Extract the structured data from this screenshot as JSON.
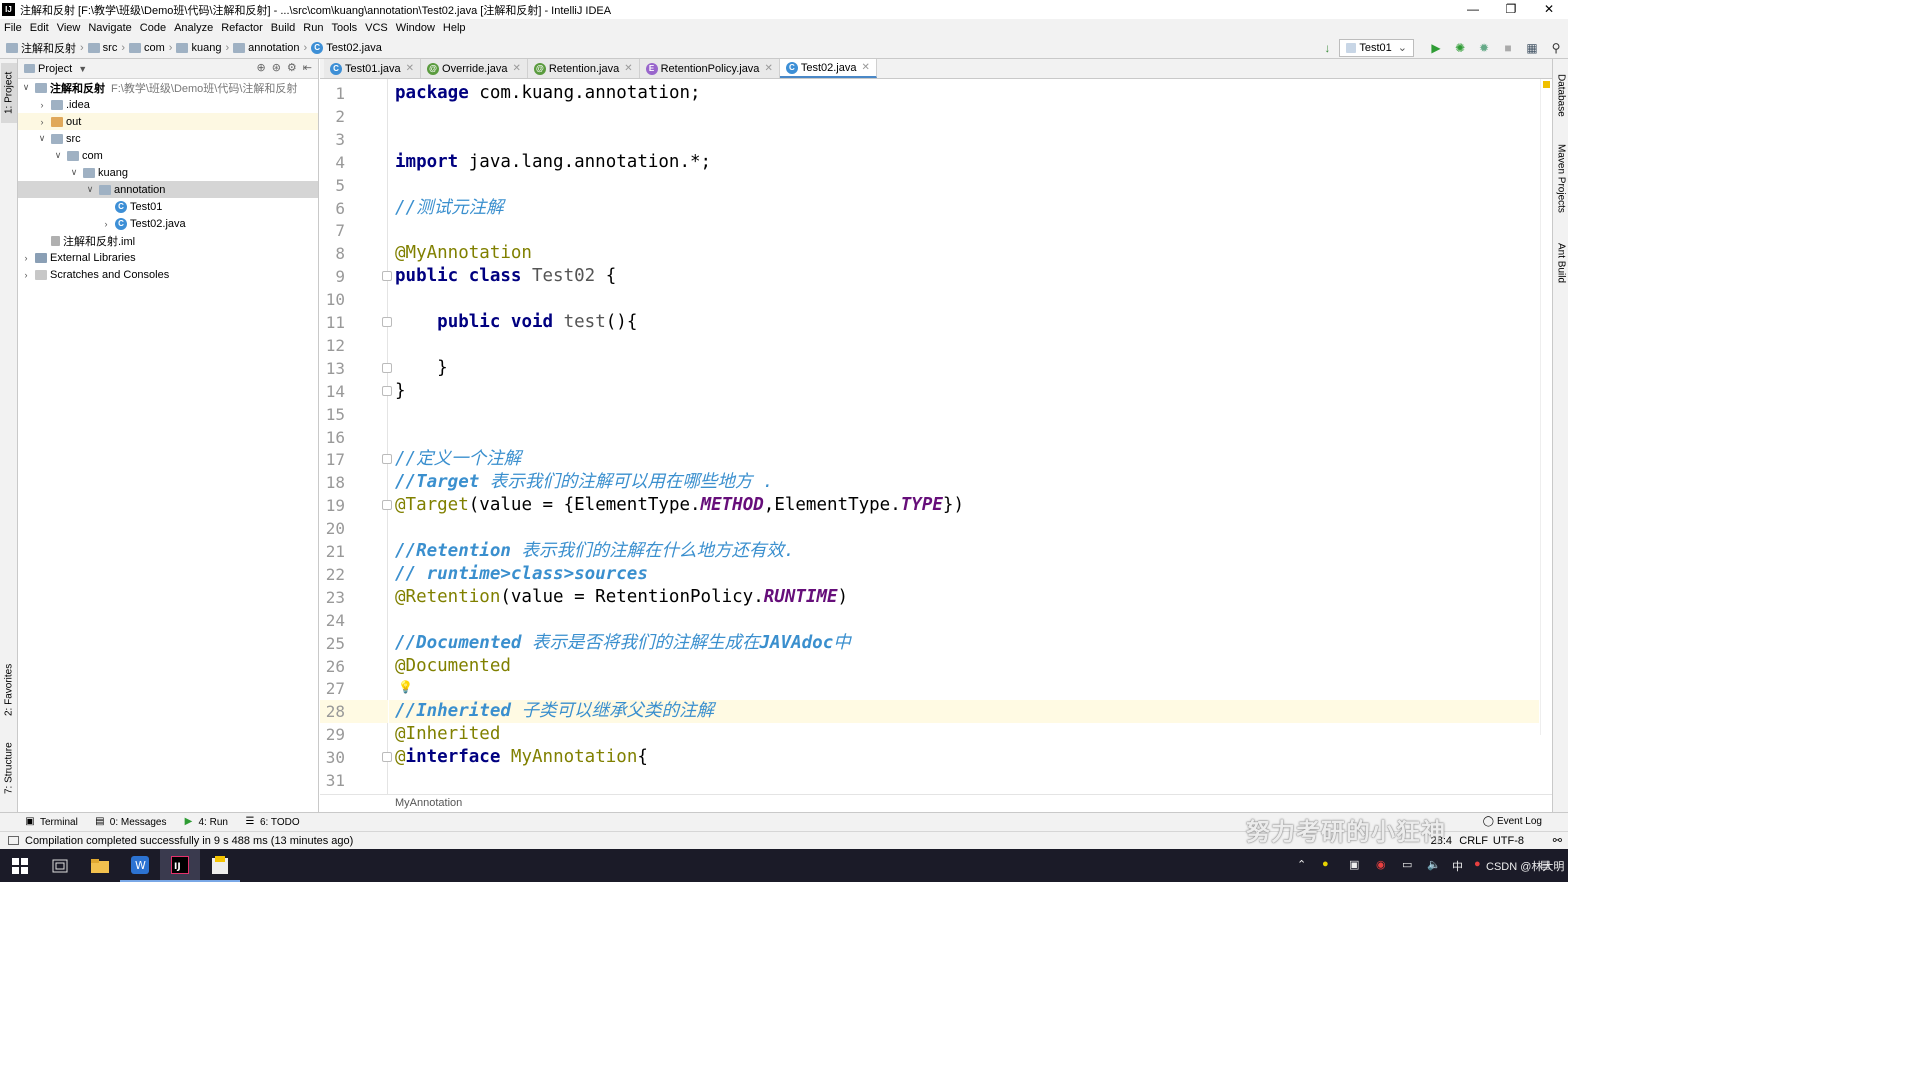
{
  "window": {
    "title": "注解和反射 [F:\\教学\\班级\\Demo班\\代码\\注解和反射] - ...\\src\\com\\kuang\\annotation\\Test02.java [注解和反射] - IntelliJ IDEA",
    "app_icon": "IJ"
  },
  "menu": [
    "File",
    "Edit",
    "View",
    "Navigate",
    "Code",
    "Analyze",
    "Refactor",
    "Build",
    "Run",
    "Tools",
    "VCS",
    "Window",
    "Help"
  ],
  "breadcrumbs": [
    "注解和反射",
    "src",
    "com",
    "kuang",
    "annotation",
    "Test02.java"
  ],
  "run_config": {
    "selected": "Test01"
  },
  "left_tabs": {
    "project": "1: Project",
    "favorites": "2: Favorites",
    "structure": "7: Structure"
  },
  "right_tabs": {
    "database": "Database",
    "maven": "Maven Projects",
    "ant": "Ant Build"
  },
  "project_panel": {
    "header": "Project",
    "tree": [
      {
        "label": "注解和反射",
        "path": "F:\\教学\\班级\\Demo班\\代码\\注解和反射",
        "depth": 0,
        "arrow": "v",
        "icon": "folder-icon"
      },
      {
        "label": ".idea",
        "depth": 1,
        "arrow": ">",
        "icon": "folder-icon"
      },
      {
        "label": "out",
        "depth": 1,
        "arrow": ">",
        "icon": "folder-orange-icon"
      },
      {
        "label": "src",
        "depth": 1,
        "arrow": "v",
        "icon": "folder-icon"
      },
      {
        "label": "com",
        "depth": 2,
        "arrow": "v",
        "icon": "package-icon"
      },
      {
        "label": "kuang",
        "depth": 3,
        "arrow": "v",
        "icon": "package-icon"
      },
      {
        "label": "annotation",
        "depth": 4,
        "arrow": "v",
        "icon": "package-icon"
      },
      {
        "label": "Test01",
        "depth": 5,
        "arrow": "",
        "icon": "class-icon"
      },
      {
        "label": "Test02.java",
        "depth": 5,
        "arrow": ">",
        "icon": "class-icon"
      },
      {
        "label": "注解和反射.iml",
        "depth": 1,
        "arrow": "",
        "icon": "iml-icon"
      },
      {
        "label": "External Libraries",
        "depth": 0,
        "arrow": ">",
        "icon": "library-icon"
      },
      {
        "label": "Scratches and Consoles",
        "depth": 0,
        "arrow": ">",
        "icon": "scratch-icon"
      }
    ]
  },
  "tabs": [
    {
      "label": "Test01.java",
      "icon": "C"
    },
    {
      "label": "Override.java",
      "icon": "@"
    },
    {
      "label": "Retention.java",
      "icon": "@"
    },
    {
      "label": "RetentionPolicy.java",
      "icon": "E"
    },
    {
      "label": "Test02.java",
      "icon": "C"
    }
  ],
  "code": {
    "line_numbers": [
      "1",
      "2",
      "3",
      "4",
      "5",
      "6",
      "7",
      "8",
      "9",
      "10",
      "11",
      "12",
      "13",
      "14",
      "15",
      "16",
      "17",
      "18",
      "19",
      "20",
      "21",
      "22",
      "23",
      "24",
      "25",
      "26",
      "27",
      "28",
      "29",
      "30",
      "31"
    ],
    "lines": [
      [
        [
          "kw",
          "package"
        ],
        [
          "fn",
          " com.kuang.annotation;"
        ]
      ],
      [],
      [],
      [
        [
          "kw",
          "import"
        ],
        [
          "fn",
          " java.lang.annotation.*;"
        ]
      ],
      [],
      [
        [
          "cm",
          "//测试元注解"
        ]
      ],
      [],
      [
        [
          "an",
          "@MyAnnotation"
        ]
      ],
      [
        [
          "kw",
          "public class"
        ],
        [
          "fn",
          " "
        ],
        [
          "gr",
          "Test02"
        ],
        [
          "fn",
          " {"
        ]
      ],
      [],
      [
        [
          "fn",
          "    "
        ],
        [
          "kw",
          "public void"
        ],
        [
          "fn",
          " "
        ],
        [
          "gr",
          "test"
        ],
        [
          "fn",
          "(){"
        ]
      ],
      [],
      [
        [
          "fn",
          "    }"
        ]
      ],
      [
        [
          "fn",
          "}"
        ]
      ],
      [],
      [],
      [
        [
          "cm",
          "//定义一个注解"
        ]
      ],
      [
        [
          "cmb",
          "//Target"
        ],
        [
          "cm",
          " 表示我们的注解可以用在哪些地方 ."
        ]
      ],
      [
        [
          "an",
          "@Target"
        ],
        [
          "fn",
          "(value = {ElementType."
        ],
        [
          "cn",
          "METHOD"
        ],
        [
          "fn",
          ",ElementType."
        ],
        [
          "cn",
          "TYPE"
        ],
        [
          "fn",
          "})"
        ]
      ],
      [],
      [
        [
          "cmb",
          "//Retention"
        ],
        [
          "cm",
          " 表示我们的注解在什么地方还有效."
        ]
      ],
      [
        [
          "cmb",
          "// runtime>class>sources"
        ]
      ],
      [
        [
          "an",
          "@Retention"
        ],
        [
          "fn",
          "(value = RetentionPolicy."
        ],
        [
          "cn",
          "RUNTIME"
        ],
        [
          "fn",
          ")"
        ]
      ],
      [],
      [
        [
          "cmb",
          "//Documented"
        ],
        [
          "cm",
          " 表示是否将我们的注解生成在"
        ],
        [
          "cmb",
          "JAVAdoc"
        ],
        [
          "cm",
          "中"
        ]
      ],
      [
        [
          "an",
          "@Documented"
        ]
      ],
      [],
      [
        [
          "cmb",
          "//Inherited"
        ],
        [
          "cm",
          " 子类可以继承父类的注解"
        ]
      ],
      [
        [
          "an",
          "@Inherited"
        ]
      ],
      [
        [
          "an",
          "@"
        ],
        [
          "kw",
          "interface"
        ],
        [
          "fn",
          " "
        ],
        [
          "an",
          "MyAnnotation"
        ],
        [
          "fn",
          "{"
        ]
      ],
      []
    ],
    "current_line": 28,
    "fold_lines": [
      9,
      11,
      13,
      14,
      17,
      19,
      30
    ],
    "breadcrumb": "MyAnnotation"
  },
  "tool_windows": [
    {
      "label": "Terminal",
      "icon": "terminal-icon"
    },
    {
      "label": "0: Messages",
      "icon": "messages-icon"
    },
    {
      "label": "4: Run",
      "icon": "run-icon"
    },
    {
      "label": "6: TODO",
      "icon": "todo-icon"
    }
  ],
  "event_log": "Event Log",
  "status": {
    "message": "Compilation completed successfully in 9 s 488 ms (13 minutes ago)",
    "position": "28:4",
    "line_sep": "CRLF",
    "encoding": "UTF-8"
  },
  "watermark": "努力考研的小狂神",
  "taskbar": {
    "tray": [
      "中"
    ],
    "csdn": "CSDN @林大明"
  },
  "colors": {
    "keyword": "#000080",
    "comment": "#3a8fce",
    "annotation": "#808000",
    "constant": "#660e7a",
    "current_line": "#fffae3",
    "taskbar": "#1b1b28"
  }
}
